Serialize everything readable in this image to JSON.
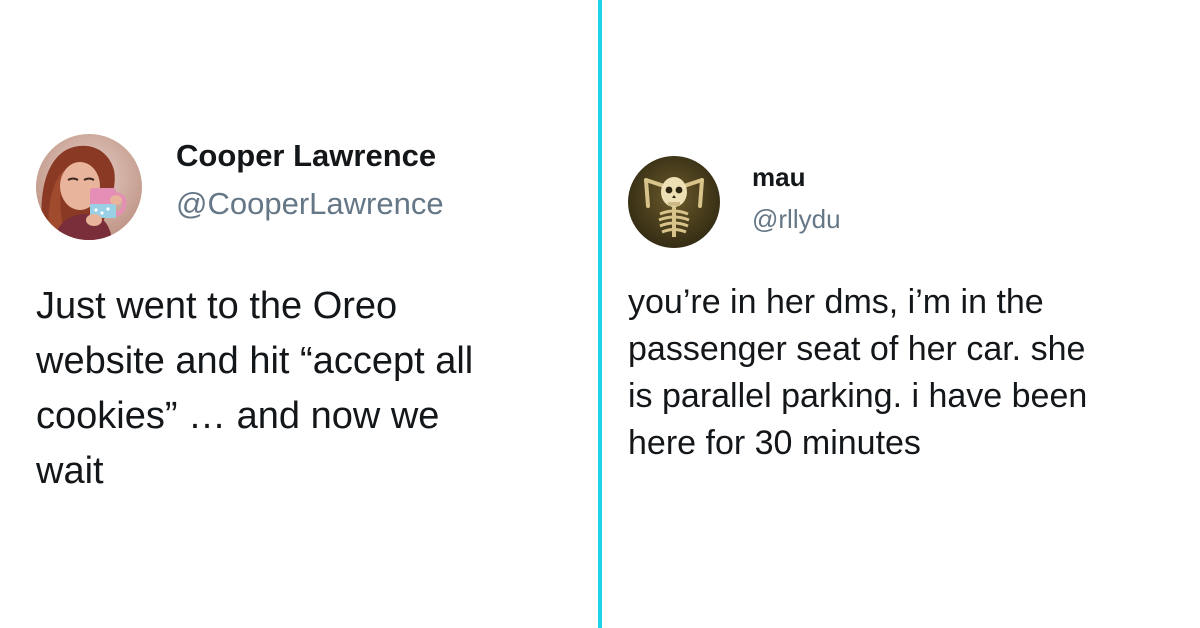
{
  "divider": {
    "color": "#1dd3e8"
  },
  "tweets": [
    {
      "avatar_icon": "woman-holding-cookie-mug-avatar",
      "display_name": "Cooper Lawrence",
      "handle": "@CooperLawrence",
      "text_lines": [
        "Just went to the Oreo",
        "website and hit “accept all",
        "cookies” … and now we",
        "wait"
      ]
    },
    {
      "avatar_icon": "skeleton-relaxing-avatar",
      "display_name": "mau",
      "handle": "@rllydu",
      "text_lines": [
        "you’re in her dms, i’m in the",
        "passenger seat of her car. she",
        "is parallel parking. i have been",
        "here for 30 minutes"
      ]
    }
  ]
}
